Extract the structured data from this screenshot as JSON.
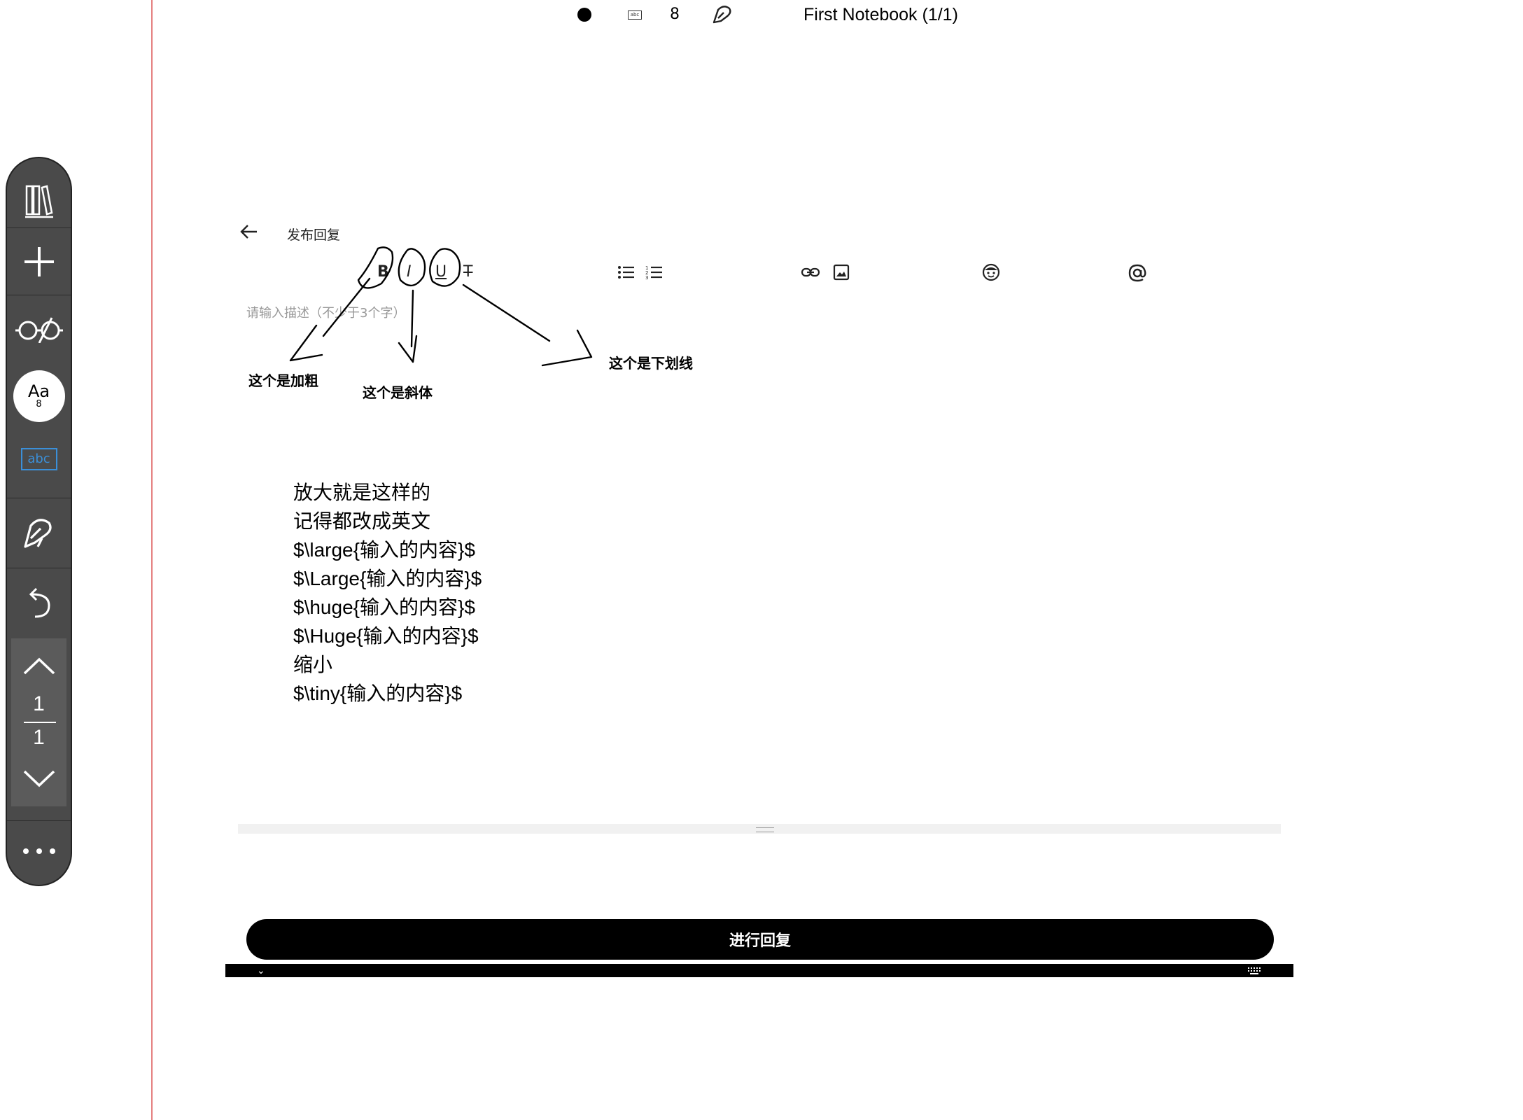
{
  "status_bar": {
    "font_size": "8",
    "abc_label": "abc",
    "notebook_title": "First Notebook (1/1)"
  },
  "sidebar": {
    "font_label": "Aa",
    "font_size": "8",
    "text_tool_label": "abc",
    "page_current": "1",
    "page_total": "1"
  },
  "reply": {
    "title": "发布回复",
    "placeholder": "请输入描述（不少于3个字）",
    "toolbar": {
      "bold": "B",
      "italic": "I",
      "underline": "U",
      "clear": "T"
    },
    "submit_label": "进行回复"
  },
  "annotations": {
    "bold": "这个是加粗",
    "italic": "这个是斜体",
    "underline": "这个是下划线"
  },
  "handwritten_lines": [
    "放大就是这样的",
    "记得都改成英文",
    "$\\large{输入的内容}$",
    "$\\Large{输入的内容}$",
    "$\\huge{输入的内容}$",
    "$\\Huge{输入的内容}$",
    "缩小",
    "$\\tiny{输入的内容}$"
  ]
}
